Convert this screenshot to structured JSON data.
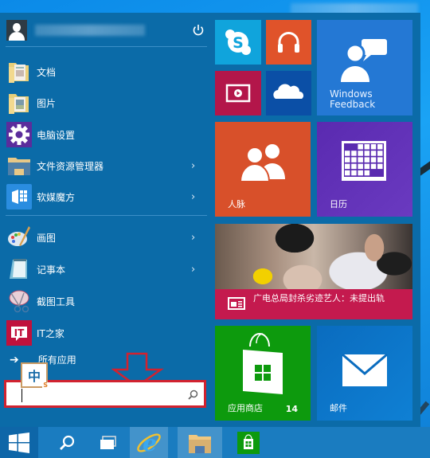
{
  "window": {
    "title_blurred": true
  },
  "user": {
    "name_blurred": true,
    "avatar_icon": "user-icon",
    "power_icon": "power-icon"
  },
  "pinned_places": [
    {
      "label": "文档",
      "icon": "documents-folder-icon",
      "has_submenu": false
    },
    {
      "label": "图片",
      "icon": "pictures-folder-icon",
      "has_submenu": false
    },
    {
      "label": "电脑设置",
      "icon": "settings-gear-icon",
      "has_submenu": false
    },
    {
      "label": "文件资源管理器",
      "icon": "file-explorer-icon",
      "has_submenu": true
    },
    {
      "label": "软媒魔方",
      "icon": "ruanmei-mofang-icon",
      "has_submenu": true
    }
  ],
  "recent_apps": [
    {
      "label": "画图",
      "icon": "paint-palette-icon",
      "has_submenu": true
    },
    {
      "label": "记事本",
      "icon": "notepad-icon",
      "has_submenu": true
    },
    {
      "label": "截图工具",
      "icon": "snipping-tool-icon",
      "has_submenu": false
    },
    {
      "label": "IT之家",
      "icon": "ithome-icon",
      "has_submenu": false
    }
  ],
  "all_apps": {
    "label": "所有应用",
    "icon": "arrow-right-icon"
  },
  "ime": {
    "char": "中",
    "sub": "S"
  },
  "search": {
    "value": "",
    "placeholder": "",
    "icon": "search-icon"
  },
  "annotation": {
    "type": "red-down-arrow",
    "color": "#d2222f"
  },
  "tiles": [
    {
      "id": "skype",
      "label": "",
      "icon": "skype-icon",
      "color": "#10a4dc"
    },
    {
      "id": "music",
      "label": "",
      "icon": "headphones-icon",
      "color": "#e0532a"
    },
    {
      "id": "windows-feedback",
      "label": "Windows Feedback",
      "icon": "feedback-person-icon",
      "color": "#2478d4"
    },
    {
      "id": "video",
      "label": "",
      "icon": "video-play-icon",
      "color": "#b3164a"
    },
    {
      "id": "onedrive",
      "label": "",
      "icon": "onedrive-cloud-icon",
      "color": "#0b4fa6"
    },
    {
      "id": "people",
      "label": "人脉",
      "icon": "people-icon",
      "color": "#d8502a"
    },
    {
      "id": "calendar",
      "label": "日历",
      "icon": "calendar-icon",
      "color": "#5c2eb0"
    },
    {
      "id": "news",
      "label": "广电总局封杀劣迹艺人：未提出轨",
      "icon": "news-icon",
      "color": "#c41a4e"
    },
    {
      "id": "store",
      "label": "应用商店",
      "badge": "14",
      "icon": "store-bag-icon",
      "color": "#0d9a0d"
    },
    {
      "id": "mail",
      "label": "邮件",
      "icon": "mail-envelope-icon",
      "color": "#0e73c6"
    }
  ],
  "taskbar": {
    "items": [
      {
        "name": "start",
        "icon": "windows-logo-icon"
      },
      {
        "name": "search",
        "icon": "search-icon"
      },
      {
        "name": "task-view",
        "icon": "task-view-icon"
      },
      {
        "name": "internet-explorer",
        "icon": "ie-icon"
      },
      {
        "name": "file-explorer",
        "icon": "folder-icon"
      },
      {
        "name": "store",
        "icon": "store-bag-icon"
      }
    ]
  },
  "colors": {
    "menu_bg": "#0b6ba8",
    "taskbar_bg": "#1a7cc0",
    "highlight_red": "#d2222f"
  }
}
